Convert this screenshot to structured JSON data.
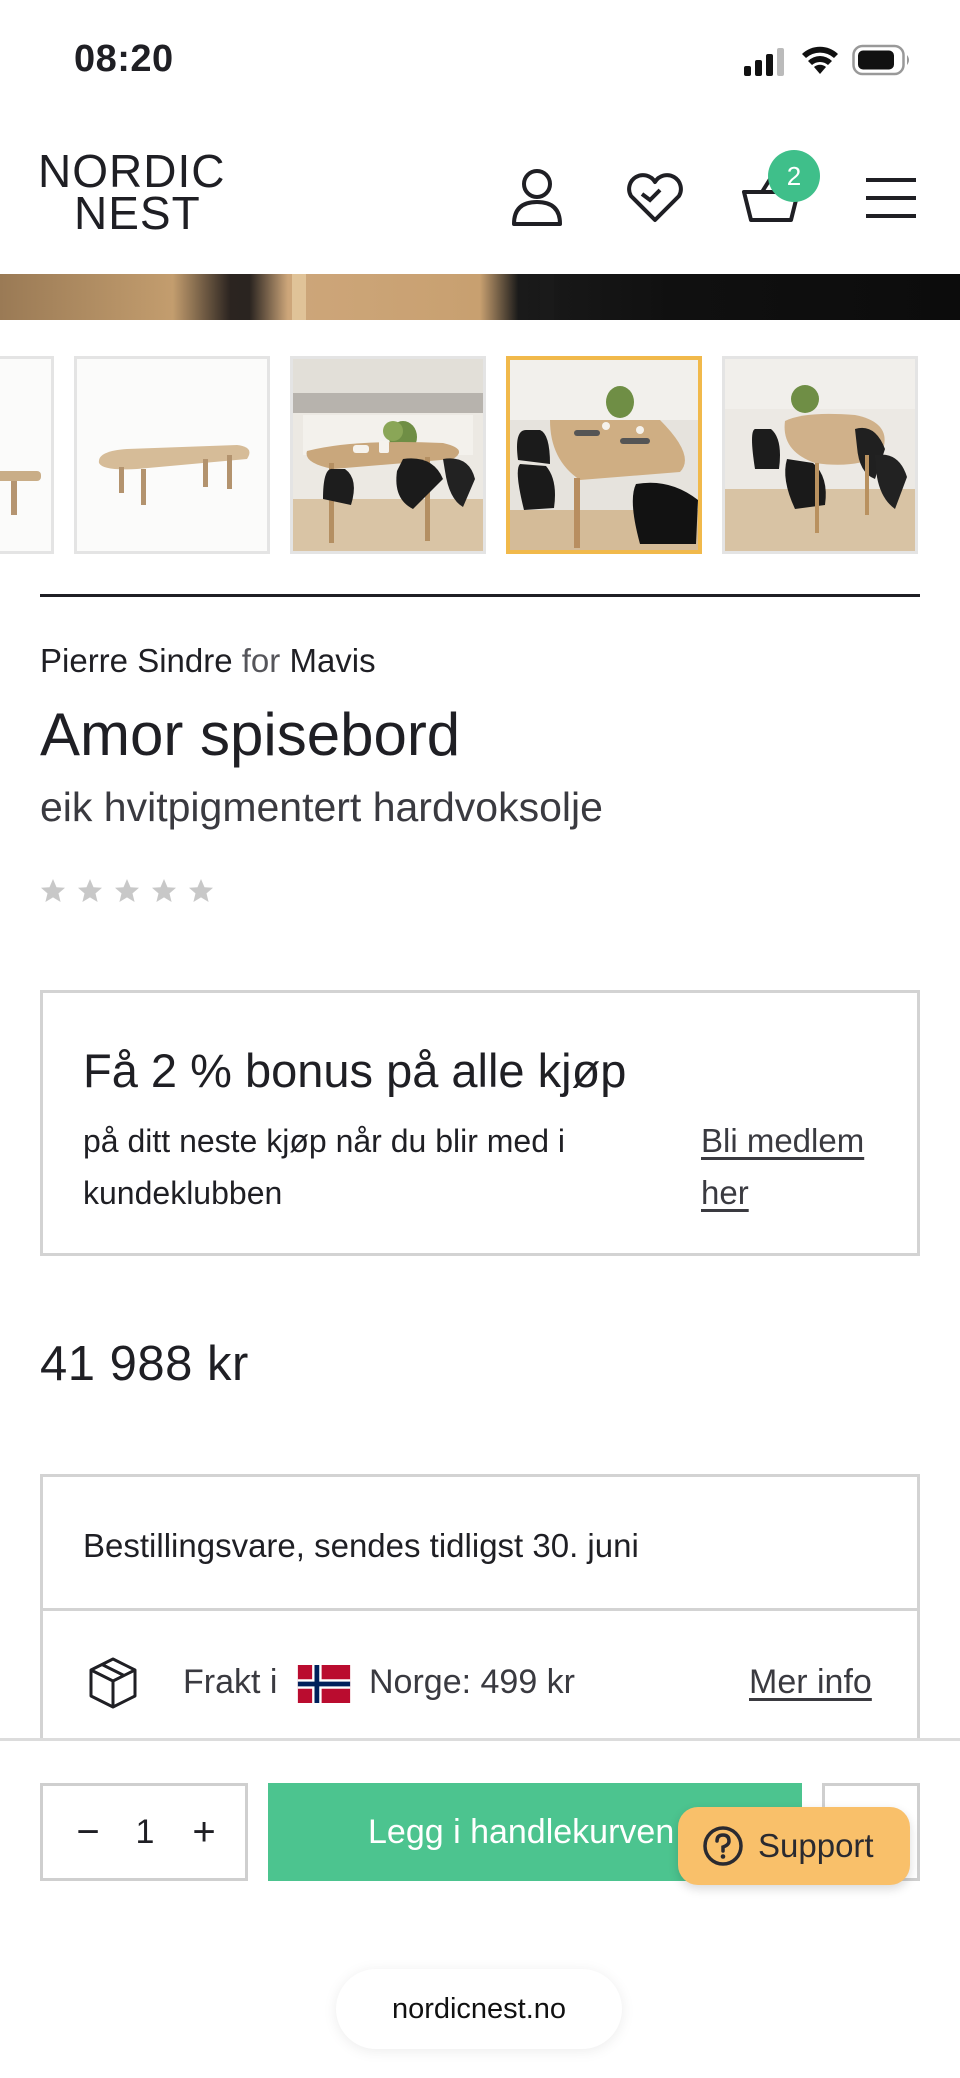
{
  "status_bar": {
    "time": "08:20"
  },
  "header": {
    "logo_line1": "NORDIC",
    "logo_line2": "NEST",
    "cart_count": "2",
    "icons": [
      "user-icon",
      "heart-icon",
      "cart-icon",
      "menu-icon"
    ]
  },
  "gallery": {
    "thumbnails": [
      "table-side-view",
      "table-angled-view",
      "kitchen-scene",
      "dining-scene",
      "dining-room-scene"
    ],
    "active_index": 3,
    "active_color": "#f1b94b"
  },
  "product": {
    "designer": "Pierre Sindre",
    "for_word": "for",
    "brand": "Mavis",
    "title": "Amor spisebord",
    "variant": "eik hvitpigmentert hardvoksolje",
    "rating_stars": 5,
    "rating_filled": 0
  },
  "bonus": {
    "title": "Få 2 % bonus på alle kjøp",
    "description": "på ditt neste kjøp når du blir med i kundeklubben",
    "link_label": "Bli medlem her"
  },
  "price": "41 988 kr",
  "delivery": {
    "status_strong": "Bestillingsvare",
    "status_rest": ", sendes tidligst 30. juni",
    "shipping_label": "Frakt i",
    "shipping_country_price": "Norge: 499 kr",
    "more_info_label": "Mer info"
  },
  "purchase": {
    "quantity": "1",
    "minus_label": "−",
    "plus_label": "+",
    "add_to_cart_label": "Legg i handlekurven",
    "accent_color": "#4cc48f"
  },
  "support": {
    "label": "Support",
    "color": "#f9c06a"
  },
  "browser": {
    "url": "nordicnest.no"
  }
}
